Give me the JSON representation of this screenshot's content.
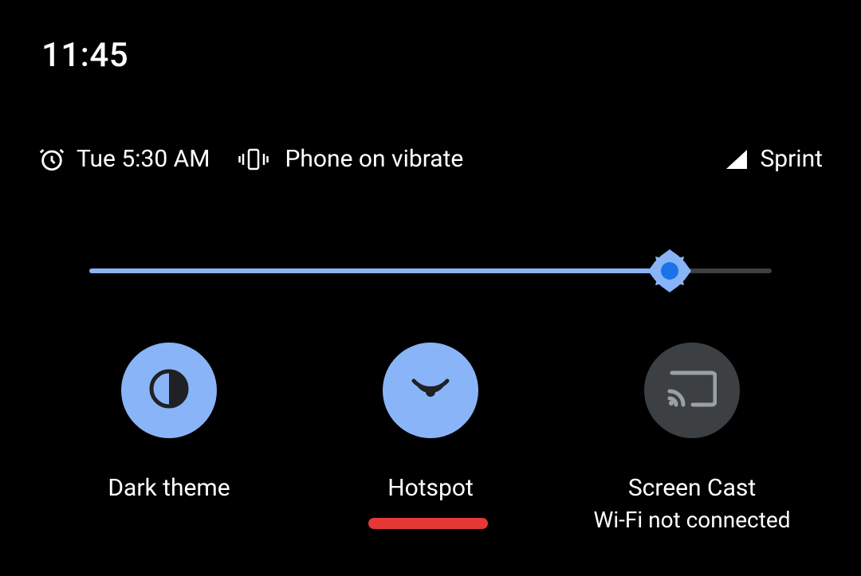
{
  "clock": "11:45",
  "status": {
    "alarm_time": "Tue 5:30 AM",
    "ringer_mode": "Phone on vibrate",
    "carrier": "Sprint"
  },
  "brightness": {
    "percent": 85
  },
  "tiles": [
    {
      "id": "dark-theme",
      "label": "Dark theme",
      "sublabel": "",
      "active": true,
      "icon": "contrast-icon"
    },
    {
      "id": "hotspot",
      "label": "Hotspot",
      "sublabel": "",
      "active": true,
      "icon": "hotspot-icon"
    },
    {
      "id": "screen-cast",
      "label": "Screen Cast",
      "sublabel": "Wi-Fi not connected",
      "active": false,
      "icon": "cast-icon"
    }
  ],
  "colors": {
    "accent": "#8ab4f8",
    "inactive_tile": "#3c4043",
    "annotation": "#e53935"
  }
}
